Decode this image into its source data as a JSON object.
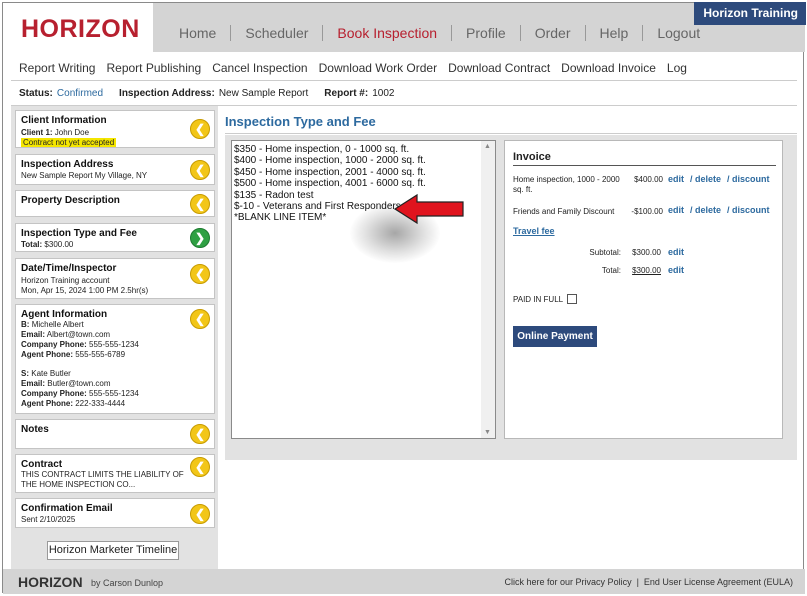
{
  "header": {
    "logo": "HORIZON",
    "account_badge": "Horizon Training",
    "nav": [
      {
        "label": "Home"
      },
      {
        "label": "Scheduler"
      },
      {
        "label": "Book Inspection"
      },
      {
        "label": "Profile"
      },
      {
        "label": "Order"
      },
      {
        "label": "Help"
      },
      {
        "label": "Logout"
      }
    ],
    "active_color": "#b7202f",
    "badge_color": "#2d4a7c"
  },
  "subnav": [
    {
      "label": "Report Writing"
    },
    {
      "label": "Report Publishing"
    },
    {
      "label": "Cancel Inspection"
    },
    {
      "label": "Download Work Order"
    },
    {
      "label": "Download Contract"
    },
    {
      "label": "Download Invoice"
    },
    {
      "label": "Log"
    }
  ],
  "status": {
    "status_label": "Status:",
    "status_value": "Confirmed",
    "address_label": "Inspection Address:",
    "address_value": "New Sample Report",
    "report_label": "Report #:",
    "report_value": "1002"
  },
  "sidebar": {
    "client": {
      "title": "Client Information",
      "client_label": "Client 1:",
      "client_name": "John Doe",
      "warning": "Contract not yet accepted",
      "icon": "arrow-left-icon"
    },
    "address": {
      "title": "Inspection Address",
      "line": "New Sample Report  My Village, NY",
      "icon": "arrow-left-icon"
    },
    "property": {
      "title": "Property Description",
      "icon": "arrow-left-icon"
    },
    "fee": {
      "title": "Inspection Type and Fee",
      "total_label": "Total:",
      "total_value": "$300.00",
      "icon": "arrow-right-icon"
    },
    "datetime": {
      "title": "Date/Time/Inspector",
      "line1": "Horizon Training account",
      "line2": "Mon, Apr 15, 2024 1:00 PM 2.5hr(s)",
      "icon": "arrow-left-icon"
    },
    "agent": {
      "title": "Agent Information",
      "b_label": "B:",
      "b_name": "Michelle Albert",
      "email_label": "Email:",
      "b_email": "Albert@town.com",
      "company_phone_label": "Company Phone:",
      "b_company_phone": "555-555-1234",
      "agent_phone_label": "Agent Phone:",
      "b_agent_phone": "555-555-6789",
      "s_label": "S:",
      "s_name": "Kate Butler",
      "s_email": "Butler@town.com",
      "s_company_phone": "555-555-1234",
      "s_agent_phone": "222-333-4444",
      "icon": "arrow-left-icon"
    },
    "notes": {
      "title": "Notes",
      "icon": "arrow-left-icon"
    },
    "contract": {
      "title": "Contract",
      "line1": "THIS CONTRACT LIMITS THE LIABILITY OF",
      "line2": "THE HOME INSPECTION CO...",
      "icon": "arrow-left-icon"
    },
    "confirmation": {
      "title": "Confirmation Email",
      "line": "Sent 2/10/2025",
      "icon": "arrow-left-icon"
    },
    "timeline_button": "Horizon Marketer Timeline"
  },
  "main": {
    "title": "Inspection Type and Fee",
    "fee_options": [
      "$350 - Home inspection, 0 - 1000 sq. ft.",
      "$400 - Home inspection, 1000 - 2000 sq. ft.",
      "$450 - Home inspection, 2001 - 4000 sq. ft.",
      "$500 - Home inspection, 4001 - 6000 sq. ft.",
      "$135 - Radon test",
      "$-10 - Veterans and First Responders",
      "*BLANK LINE ITEM*"
    ],
    "pointer_arrow_color": "#e0141e"
  },
  "invoice": {
    "title": "Invoice",
    "items": [
      {
        "desc": "Home inspection, 1000 - 2000 sq. ft.",
        "amount": "$400.00"
      },
      {
        "desc": "Friends and Family Discount",
        "amount": "-$100.00"
      }
    ],
    "edit_label": "edit",
    "delete_label": "/ delete",
    "discount_label": "/ discount",
    "travel_fee": "Travel fee",
    "subtotal_label": "Subtotal:",
    "subtotal_value": "$300.00",
    "total_label": "Total:",
    "total_value": "$300.00",
    "paid_in_full": "PAID IN FULL",
    "paid_checked": false,
    "pay_button": "Online Payment"
  },
  "footer": {
    "logo": "HORIZON",
    "by": "by Carson Dunlop",
    "privacy": "Click here for our Privacy Policy",
    "separator": "|",
    "eula": "End User License Agreement (EULA)"
  }
}
